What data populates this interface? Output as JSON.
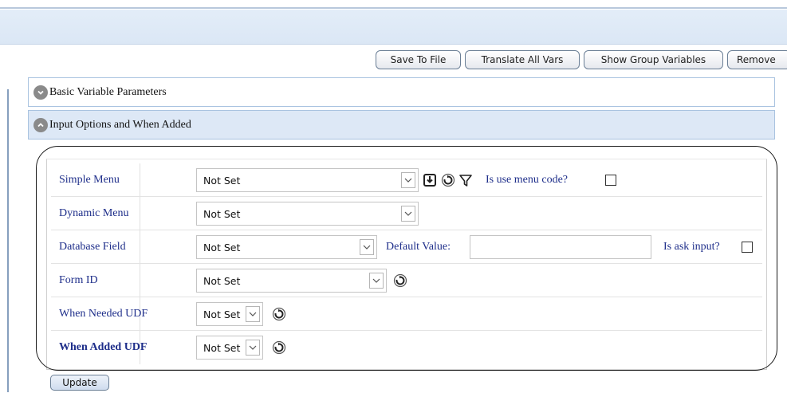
{
  "toolbar": {
    "save_to_file": "Save To File",
    "translate_all_vars": "Translate All Vars",
    "show_group_variables": "Show Group Variables",
    "remove": "Remove"
  },
  "panels": {
    "basic": {
      "title": "Basic Variable Parameters",
      "state": "collapsed",
      "icon": "chevron-down-icon"
    },
    "input": {
      "title": "Input Options and When Added",
      "state": "expanded",
      "icon": "chevron-up-icon"
    }
  },
  "form": {
    "simple_menu": {
      "label": "Simple Menu",
      "value": "Not Set",
      "use_menu_code_label": "Is use menu code?",
      "use_menu_code_checked": false
    },
    "dynamic_menu": {
      "label": "Dynamic Menu",
      "value": "Not Set"
    },
    "database_field": {
      "label": "Database Field",
      "value": "Not Set",
      "default_value_label": "Default Value:",
      "default_value": "",
      "ask_input_label": "Is ask input?",
      "ask_input_checked": false
    },
    "form_id": {
      "label": "Form ID",
      "value": "Not Set"
    },
    "when_needed_udf": {
      "label": "When Needed UDF",
      "value": "Not Set"
    },
    "when_added_udf": {
      "label": "When Added UDF",
      "value": "Not Set"
    }
  },
  "icons": [
    "download-icon",
    "refresh-icon",
    "filter-icon"
  ],
  "update_button": "Update",
  "colors": {
    "label_text": "#1e2e8a",
    "panel_header_active": "#dde8f6",
    "topbar": "#dbe7f5"
  }
}
